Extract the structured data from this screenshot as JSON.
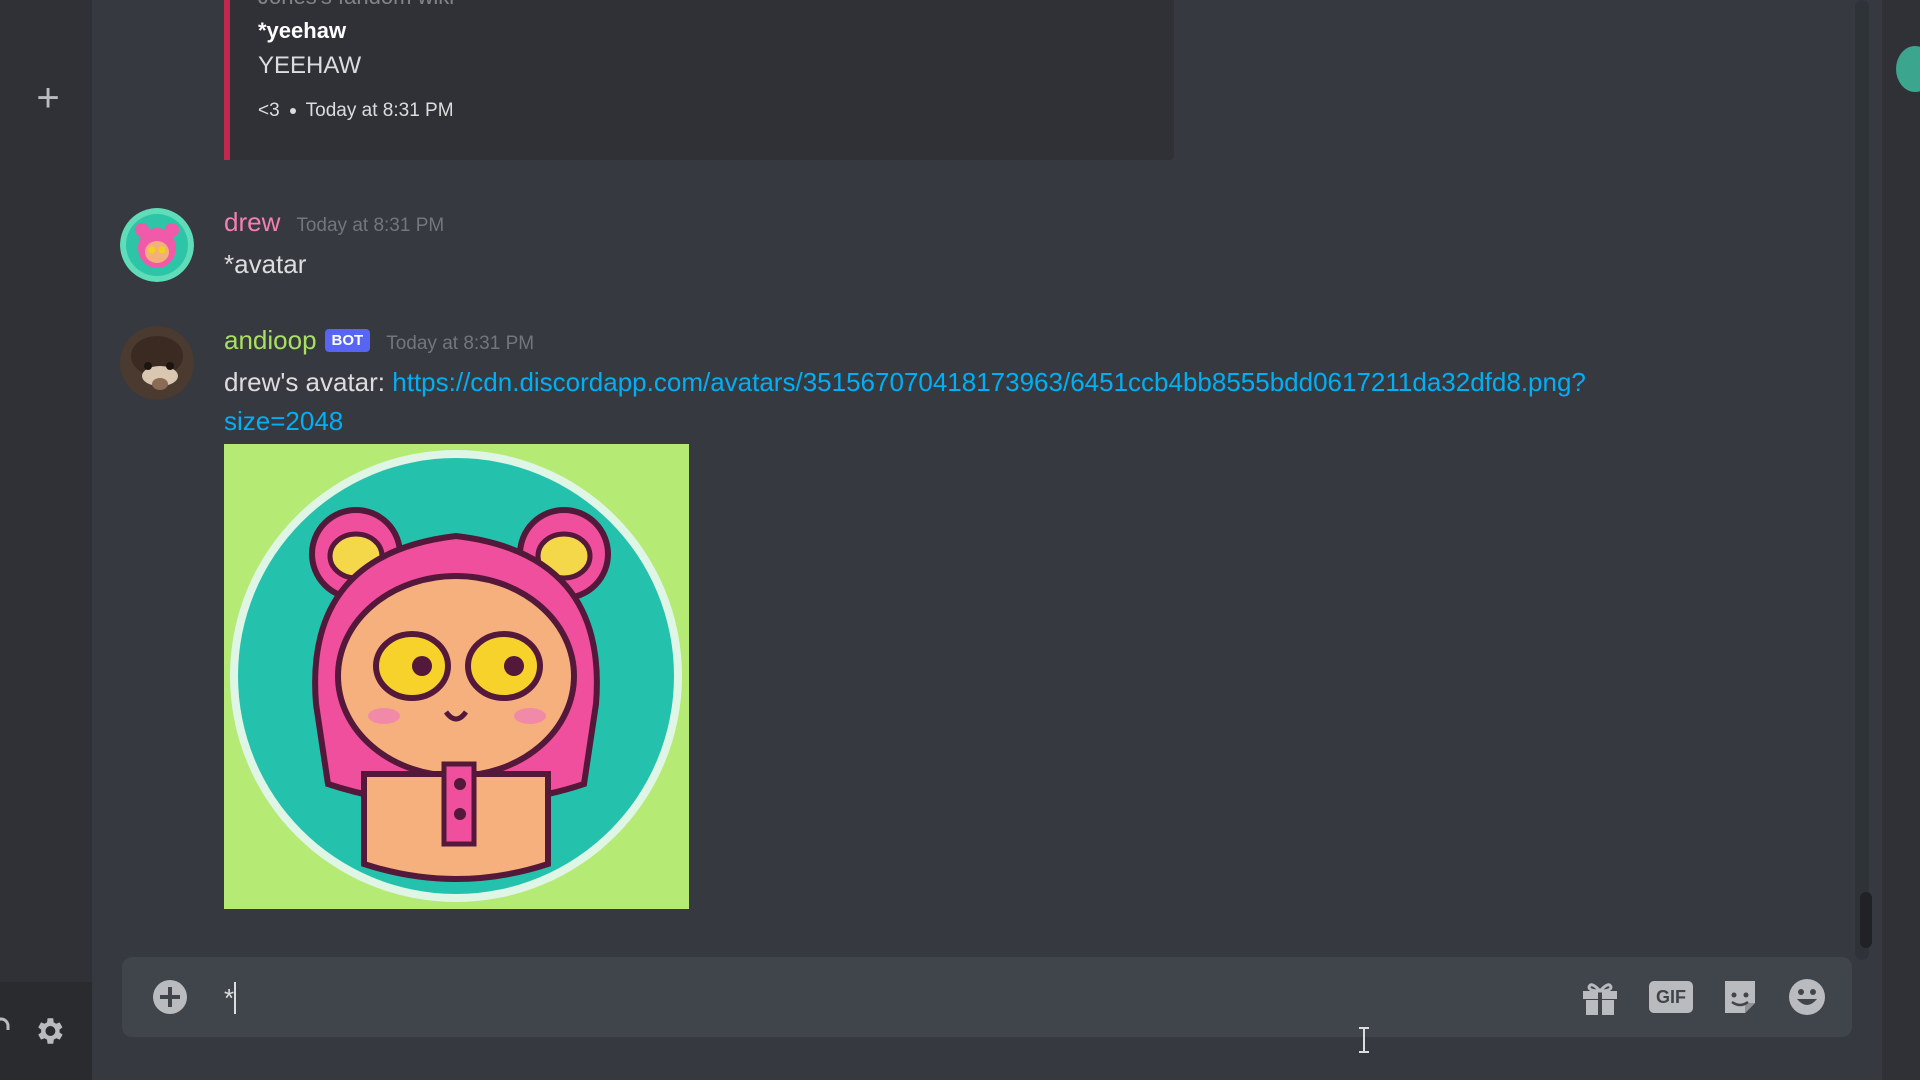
{
  "rail": {
    "add_server_label": "+"
  },
  "embed": {
    "partial_line": "Jones's fandom wiki",
    "title": "*yeehaw",
    "body": "YEEHAW",
    "footer_author": "<3",
    "footer_time": "Today at 8:31 PM"
  },
  "messages": [
    {
      "username": "drew",
      "username_color": "#f47fb4",
      "timestamp": "Today at 8:31 PM",
      "text": "*avatar"
    },
    {
      "username": "andioop",
      "username_color": "#a8e05f",
      "bot_tag": "BOT",
      "timestamp": "Today at 8:31 PM",
      "text_prefix": "drew's avatar: ",
      "link_line1": "https://cdn.discordapp.com/avatars/351567070418173963/6451ccb4bb8555bdd0617211da32dfd8.png?",
      "link_line2": "size=2048"
    }
  ],
  "composer": {
    "value": "*",
    "gif_label": "GIF",
    "icons": [
      "add-circle-icon",
      "gift-icon",
      "gif-icon",
      "sticker-icon",
      "emoji-icon"
    ]
  },
  "colors": {
    "background": "#36393f",
    "rail": "#2f3136",
    "embed_accent": "#c0284e",
    "link": "#00aff4",
    "bot_tag": "#5865f2"
  }
}
